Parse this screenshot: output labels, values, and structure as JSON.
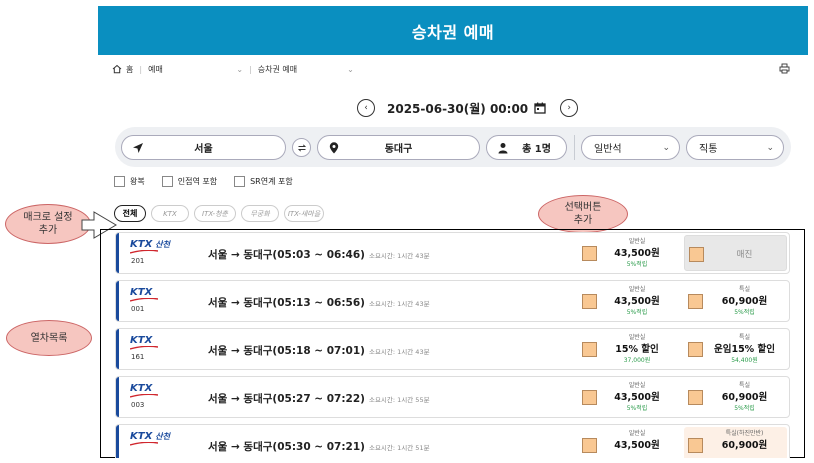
{
  "header": {
    "title": "승차권 예매"
  },
  "breadcrumb": {
    "home": "홈",
    "level1": "예매",
    "level2": "승차권 예매"
  },
  "date": {
    "text": "2025-06-30(월) 00:00"
  },
  "search": {
    "from": "서울",
    "to": "동대구",
    "passengers": "총 1명",
    "seat_class": "일반석",
    "route_type": "직통"
  },
  "options": [
    "왕복",
    "인접역 포함",
    "SR연계 포함"
  ],
  "tabs": [
    "전체",
    "KTX",
    "ITX-청춘",
    "무궁화",
    "ITX-새마을"
  ],
  "annotations": {
    "macro": [
      "매크로 설정",
      "추가"
    ],
    "select": [
      "선택버튼",
      "추가"
    ],
    "list": [
      "열차목록"
    ]
  },
  "trains": [
    {
      "logo": "KTX",
      "logo_sub": "산천",
      "number": "201",
      "route": "서울 → 동대구(05:03 ~ 06:46)",
      "duration": "소요시간: 1시간 43분",
      "general": {
        "title": "일반실",
        "price": "43,500원",
        "sub": "5%적립"
      },
      "special": {
        "soldout": "매진"
      }
    },
    {
      "logo": "KTX",
      "logo_sub": "",
      "number": "001",
      "route": "서울 → 동대구(05:13 ~ 06:56)",
      "duration": "소요시간: 1시간 43분",
      "general": {
        "title": "일반실",
        "price": "43,500원",
        "sub": "5%적립"
      },
      "special": {
        "title": "특실",
        "price": "60,900원",
        "sub": "5%적립"
      }
    },
    {
      "logo": "KTX",
      "logo_sub": "",
      "number": "161",
      "route": "서울 → 동대구(05:18 ~ 07:01)",
      "duration": "소요시간: 1시간 43분",
      "general": {
        "title": "일반실",
        "price": "15% 할인",
        "sub": "37,000원"
      },
      "special": {
        "title": "특실",
        "price": "운임15% 할인",
        "sub": "54,400원"
      }
    },
    {
      "logo": "KTX",
      "logo_sub": "",
      "number": "003",
      "route": "서울 → 동대구(05:27 ~ 07:22)",
      "duration": "소요시간: 1시간 55분",
      "general": {
        "title": "일반실",
        "price": "43,500원",
        "sub": "5%적립"
      },
      "special": {
        "title": "특실",
        "price": "60,900원",
        "sub": "5%적립"
      }
    },
    {
      "logo": "KTX",
      "logo_sub": "산천",
      "number": "",
      "route": "서울 → 동대구(05:30 ~ 07:21)",
      "duration": "소요시간: 1시간 51분",
      "general": {
        "title": "일반실",
        "price": "43,500원",
        "sub": ""
      },
      "special": {
        "title": "특실(하진만반)",
        "price": "60,900원",
        "sub": ""
      }
    }
  ],
  "colors": {
    "header_bg": "#0a8fc0",
    "accent_blue": "#1a4a9c",
    "seat_box": "#f9c893",
    "green_text": "#2a9b4a"
  }
}
